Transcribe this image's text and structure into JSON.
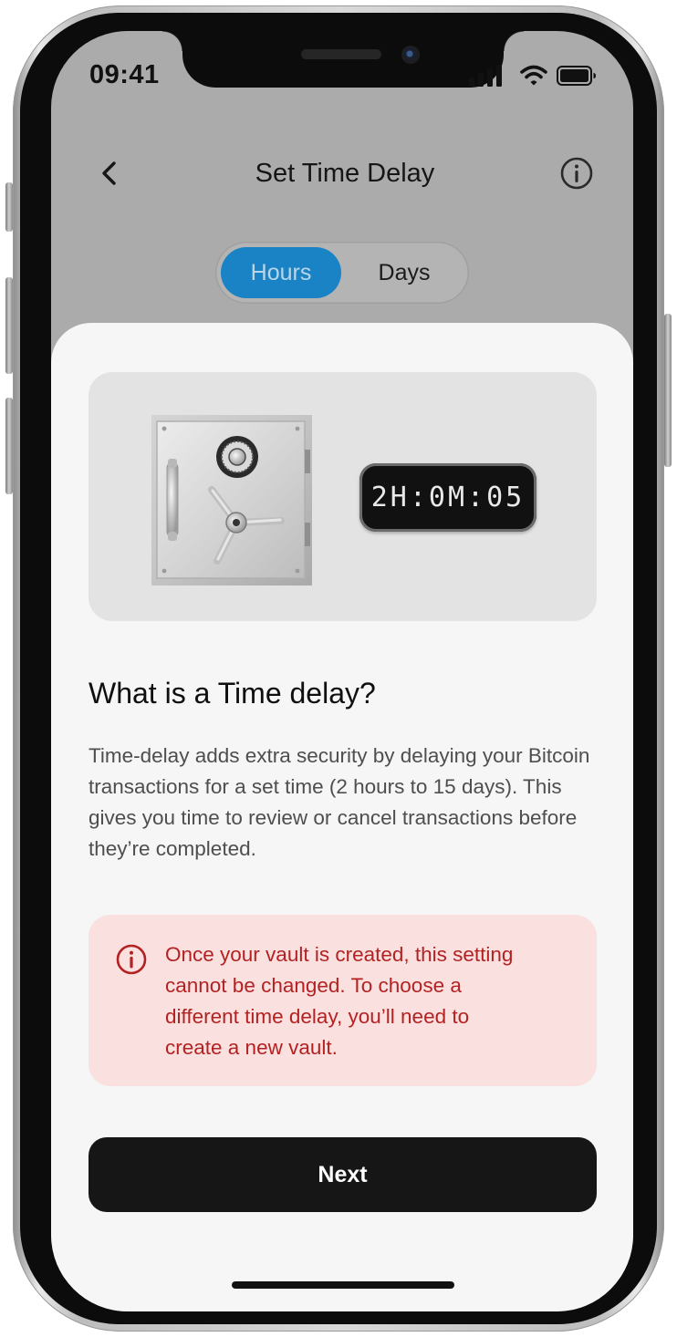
{
  "status_bar": {
    "time": "09:41"
  },
  "header": {
    "title": "Set Time Delay",
    "back_icon": "chevron-left-icon",
    "info_icon": "info-circle-icon"
  },
  "segmented_control": {
    "options": [
      "Hours",
      "Days"
    ],
    "selected": "Hours"
  },
  "hero": {
    "illustration": "safe-vault",
    "timer_display": "2H:0M:05"
  },
  "info_section": {
    "heading": "What is a Time delay?",
    "body": "Time-delay adds extra security by delaying your Bitcoin transactions for a set time (2 hours to 15 days). This gives you time to review or cancel transactions before they’re completed."
  },
  "warning": {
    "icon": "info-circle-icon",
    "text": " Once your vault is created, this setting\ncannot be changed. To choose a\ndifferent time delay, you’ll need to\ncreate a new vault."
  },
  "primary_action": {
    "label": "Next"
  },
  "colors": {
    "accent": "#1a83c6",
    "warning_background": "#fbe0e0",
    "warning_text": "#b32222",
    "button": "#161616",
    "sheet_background": "#f6f6f6",
    "header_background": "#ababab"
  }
}
